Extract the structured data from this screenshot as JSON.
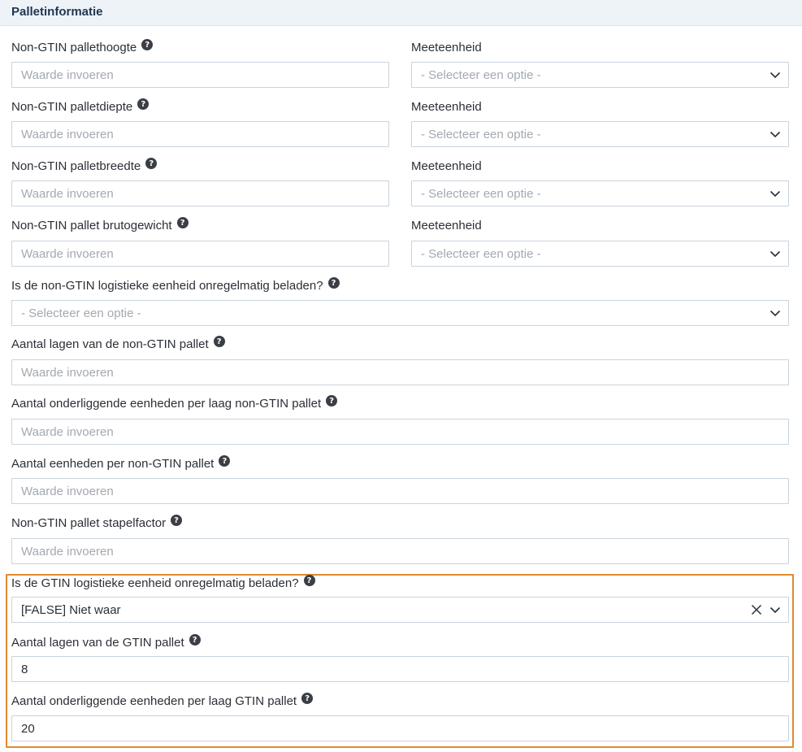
{
  "header": {
    "title": "Palletinformatie"
  },
  "help_glyph": "?",
  "rows": {
    "height": {
      "label": "Non-GTIN pallethoogte",
      "placeholder": "Waarde invoeren",
      "unit_label": "Meeteenheid",
      "unit_placeholder": "- Selecteer een optie -"
    },
    "depth": {
      "label": "Non-GTIN palletdiepte",
      "placeholder": "Waarde invoeren",
      "unit_label": "Meeteenheid",
      "unit_placeholder": "- Selecteer een optie -"
    },
    "width": {
      "label": "Non-GTIN palletbreedte",
      "placeholder": "Waarde invoeren",
      "unit_label": "Meeteenheid",
      "unit_placeholder": "- Selecteer een optie -"
    },
    "gross_weight": {
      "label": "Non-GTIN pallet brutogewicht",
      "placeholder": "Waarde invoeren",
      "unit_label": "Meeteenheid",
      "unit_placeholder": "- Selecteer een optie -"
    }
  },
  "fields": {
    "nongtin_irregular": {
      "label": "Is de non-GTIN logistieke eenheid onregelmatig beladen?",
      "placeholder": "- Selecteer een optie -"
    },
    "nongtin_layers": {
      "label": "Aantal lagen van de non-GTIN pallet",
      "placeholder": "Waarde invoeren"
    },
    "nongtin_units_per_layer": {
      "label": "Aantal onderliggende eenheden per laag non-GTIN pallet",
      "placeholder": "Waarde invoeren"
    },
    "nongtin_units_per_pallet": {
      "label": "Aantal eenheden per non-GTIN pallet",
      "placeholder": "Waarde invoeren"
    },
    "nongtin_stack_factor": {
      "label": "Non-GTIN pallet stapelfactor",
      "placeholder": "Waarde invoeren"
    },
    "gtin_irregular": {
      "label": "Is de GTIN logistieke eenheid onregelmatig beladen?",
      "value": "[FALSE] Niet waar"
    },
    "gtin_layers": {
      "label": "Aantal lagen van de GTIN pallet",
      "value": "8"
    },
    "gtin_units_per_layer": {
      "label": "Aantal onderliggende eenheden per laag GTIN pallet",
      "value": "20"
    }
  },
  "icons": {
    "help": "question-circle-icon",
    "chevron": "chevron-down-icon",
    "clear": "close-icon"
  },
  "colors": {
    "highlight": "#e08a2e",
    "header_bg": "#eef3f8"
  }
}
